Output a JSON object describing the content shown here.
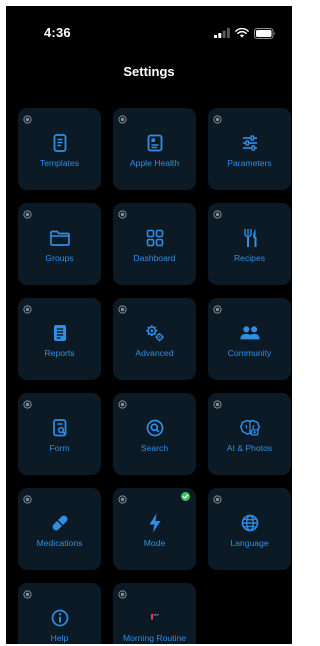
{
  "status_bar": {
    "time": "4:36",
    "icons": [
      "signal-icon",
      "wifi-icon",
      "battery-icon"
    ]
  },
  "nav": {
    "title": "Settings"
  },
  "colors": {
    "background": "#000000",
    "tile": "#0c1a26",
    "accent": "#2f8fe6",
    "pin": "#8a8f96",
    "active_check": "#3cc85a"
  },
  "tiles": [
    {
      "label": "Templates",
      "icon": "document-icon"
    },
    {
      "label": "Apple Health",
      "icon": "health-record-icon"
    },
    {
      "label": "Parameters",
      "icon": "sliders-icon"
    },
    {
      "label": "Groups",
      "icon": "folder-icon"
    },
    {
      "label": "Dashboard",
      "icon": "dashboard-grid-icon"
    },
    {
      "label": "Recipes",
      "icon": "fork-knife-icon"
    },
    {
      "label": "Reports",
      "icon": "report-icon"
    },
    {
      "label": "Advanced",
      "icon": "gears-icon"
    },
    {
      "label": "Community",
      "icon": "people-icon"
    },
    {
      "label": "Form",
      "icon": "form-search-icon"
    },
    {
      "label": "Search",
      "icon": "magnifier-icon"
    },
    {
      "label": "AI & Photos",
      "icon": "brain-icon"
    },
    {
      "label": "Medications",
      "icon": "pill-icon"
    },
    {
      "label": "Mode",
      "icon": "bolt-icon",
      "active": true
    },
    {
      "label": "Language",
      "icon": "globe-icon"
    },
    {
      "label": "Help",
      "icon": "info-icon"
    },
    {
      "label": "Morning Routine",
      "icon": "routine-flag-icon"
    }
  ]
}
